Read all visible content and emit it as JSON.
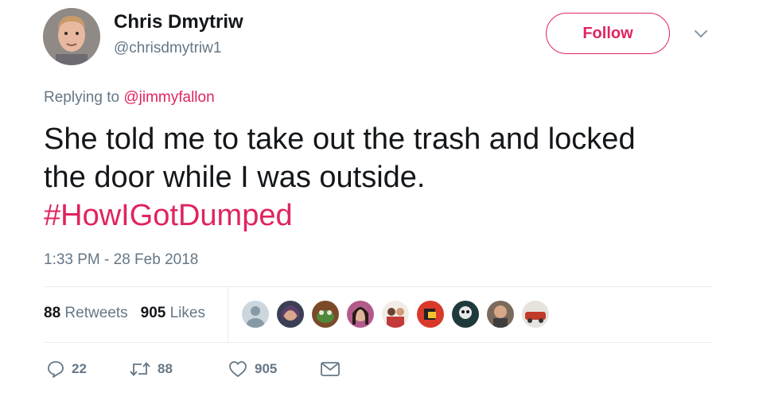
{
  "author": {
    "name": "Chris Dmytriw",
    "handle": "@chrisdmytriw1",
    "avatar_icon": "profile-photo"
  },
  "follow_label": "Follow",
  "accent_color": "#e0245e",
  "replying": {
    "prefix": "Replying to",
    "mention": "@jimmyfallon"
  },
  "tweet": {
    "line1": "She told me to take out the trash and locked",
    "line2": "the door while I was outside.",
    "hashtag": "#HowIGotDumped"
  },
  "timestamp": "1:33 PM - 28 Feb 2018",
  "stats": {
    "retweets_count": "88",
    "retweets_label": "Retweets",
    "likes_count": "905",
    "likes_label": "Likes"
  },
  "liker_avatars": [
    "default-avatar",
    "liker-avatar",
    "liker-avatar",
    "liker-avatar",
    "liker-avatar",
    "liker-avatar",
    "liker-avatar",
    "liker-avatar",
    "liker-avatar"
  ],
  "actions": {
    "reply_count": "22",
    "retweet_count": "88",
    "like_count": "905"
  }
}
